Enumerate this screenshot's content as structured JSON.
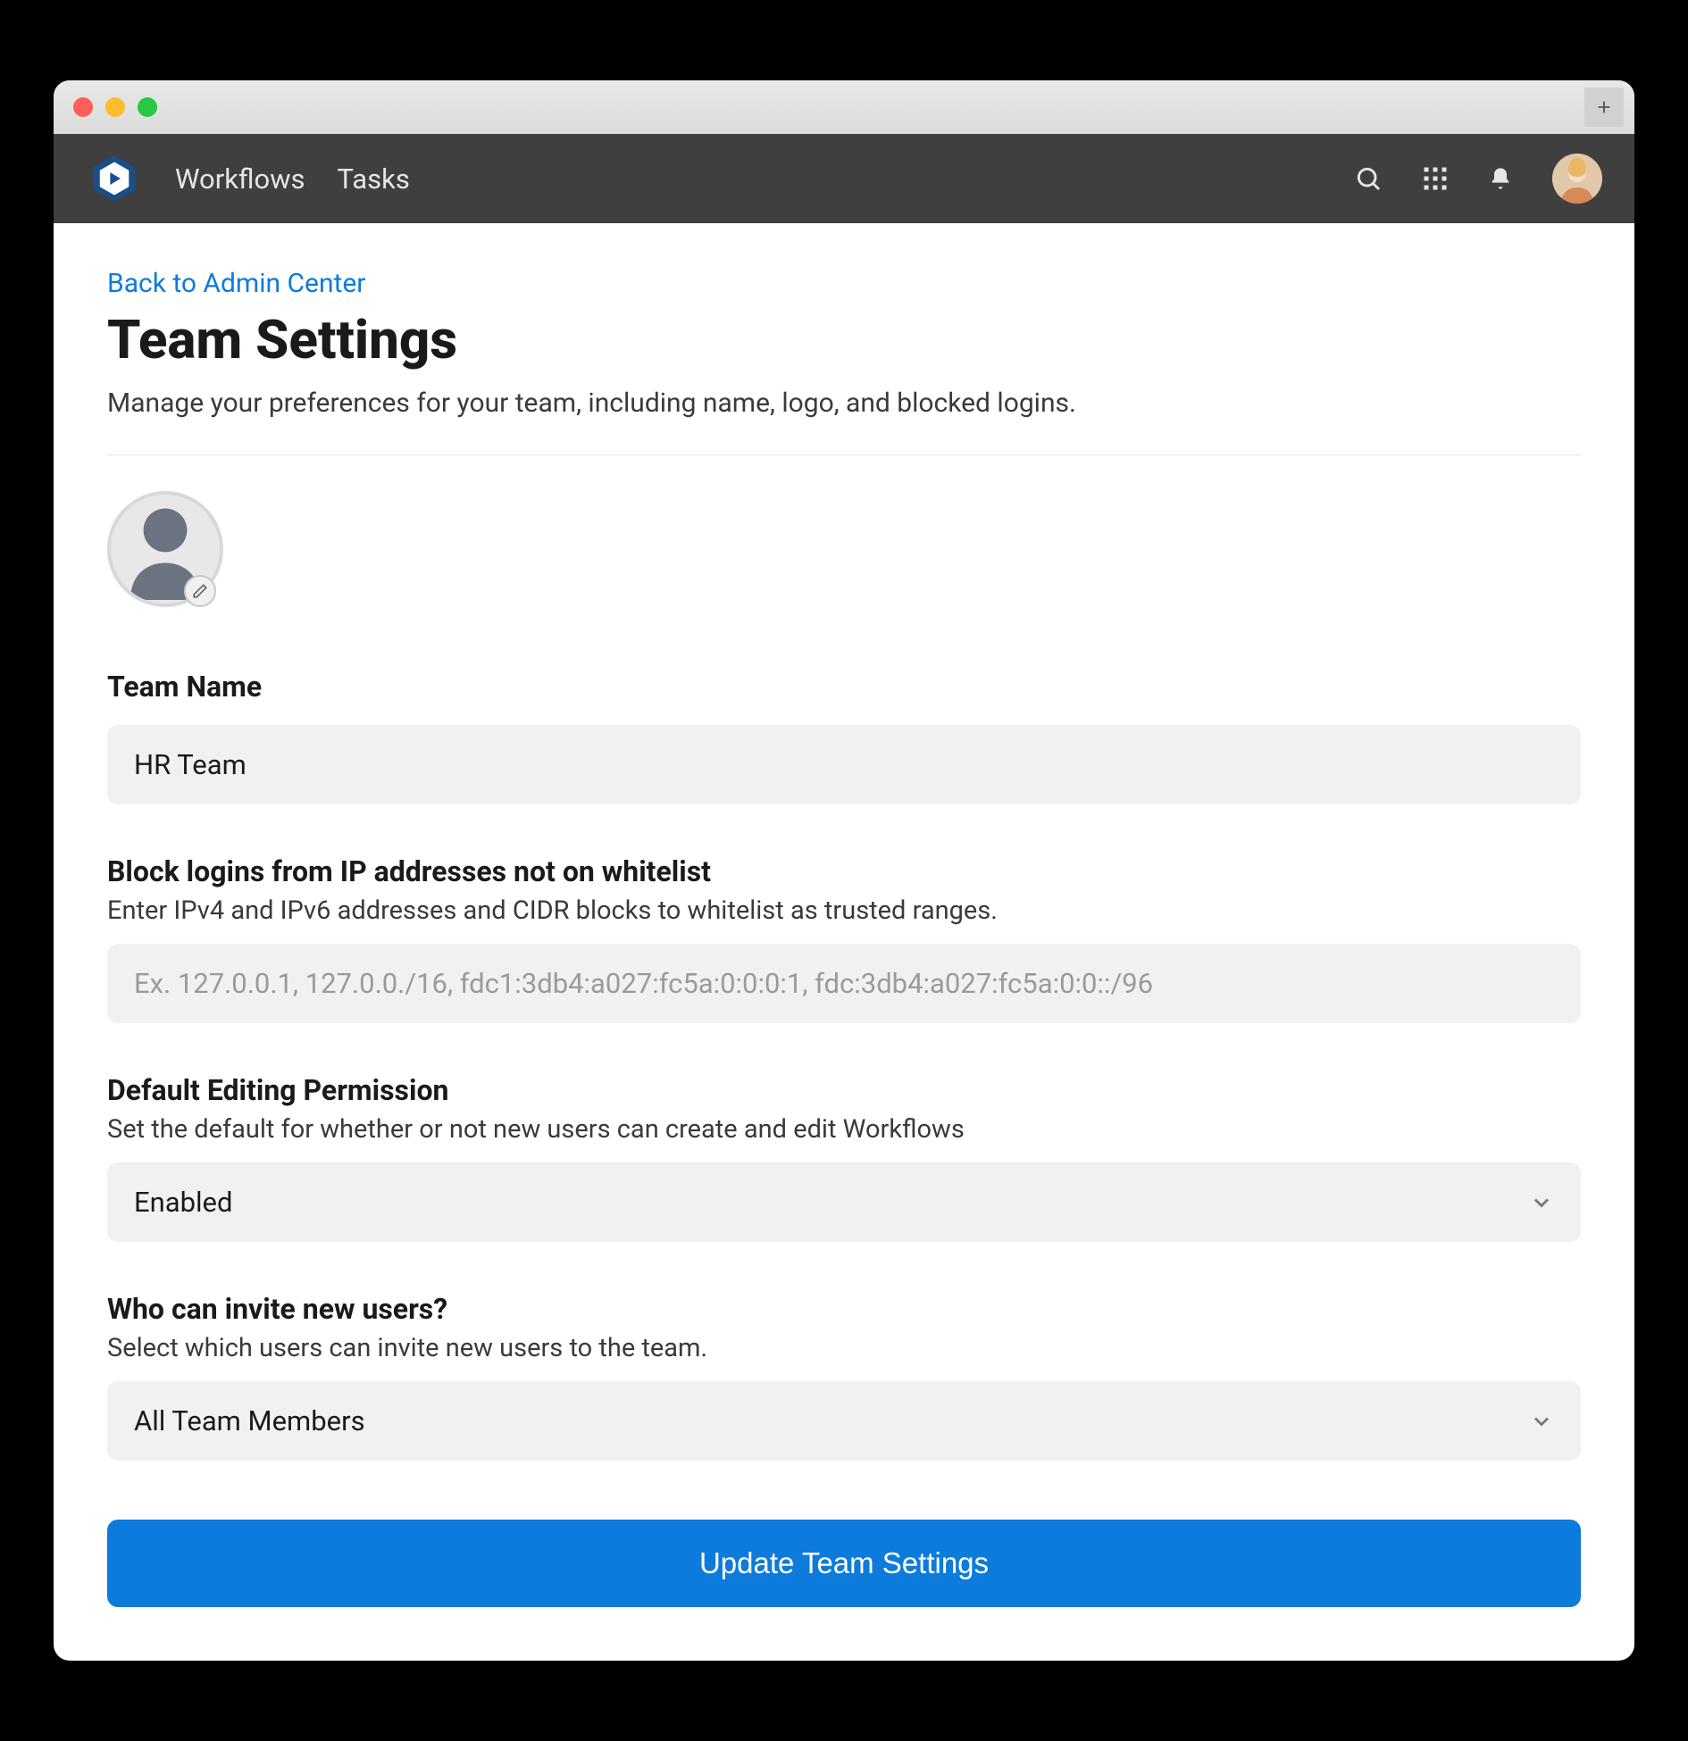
{
  "nav": {
    "links": [
      "Workflows",
      "Tasks"
    ]
  },
  "page": {
    "back_link": "Back to Admin Center",
    "title": "Team Settings",
    "description": "Manage your preferences for your team, including name, logo, and blocked logins."
  },
  "fields": {
    "team_name": {
      "label": "Team Name",
      "value": "HR Team"
    },
    "ip_whitelist": {
      "label": "Block logins from IP addresses not on whitelist",
      "help": "Enter IPv4 and IPv6 addresses and CIDR blocks to whitelist as trusted ranges.",
      "placeholder": "Ex. 127.0.0.1, 127.0.0./16, fdc1:3db4:a027:fc5a:0:0:0:1, fdc:3db4:a027:fc5a:0:0::/96",
      "value": ""
    },
    "edit_permission": {
      "label": "Default Editing Permission",
      "help": "Set the default for whether or not new users can create and edit Workflows",
      "value": "Enabled"
    },
    "invite_permission": {
      "label": "Who can invite new users?",
      "help": "Select which users can invite new users to the team.",
      "value": "All Team Members"
    }
  },
  "actions": {
    "submit": "Update Team Settings"
  }
}
